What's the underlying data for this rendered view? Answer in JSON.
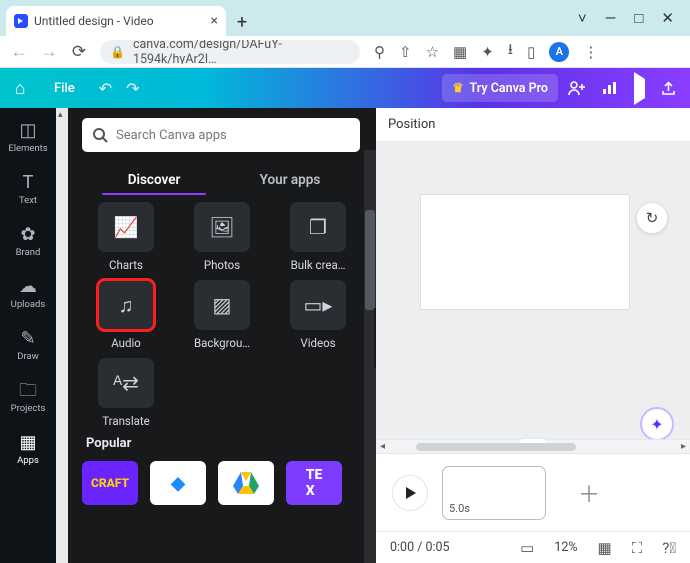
{
  "browser": {
    "tab_title": "Untitled design - Video",
    "url": "canva.com/design/DAFuY-1594k/hyAr2I…",
    "avatar_letter": "A"
  },
  "topbar": {
    "file_label": "File",
    "try_pro_label": "Try Canva Pro"
  },
  "sidebar": {
    "items": [
      {
        "label": "Elements"
      },
      {
        "label": "Text"
      },
      {
        "label": "Brand"
      },
      {
        "label": "Uploads"
      },
      {
        "label": "Draw"
      },
      {
        "label": "Projects"
      },
      {
        "label": "Apps"
      }
    ]
  },
  "panel": {
    "search_placeholder": "Search Canva apps",
    "tabs": {
      "discover": "Discover",
      "your_apps": "Your apps"
    },
    "apps_row1": [
      {
        "label": "Charts"
      },
      {
        "label": "Photos"
      },
      {
        "label": "Bulk crea…"
      }
    ],
    "apps_row2": [
      {
        "label": "Audio"
      },
      {
        "label": "Backgrou…"
      },
      {
        "label": "Videos"
      }
    ],
    "apps_row3": [
      {
        "label": "Translate"
      }
    ],
    "popular_heading": "Popular"
  },
  "canvas": {
    "position_label": "Position"
  },
  "timeline": {
    "clip_duration": "5.0s"
  },
  "status": {
    "time": "0:00 / 0:05",
    "zoom": "12%"
  }
}
